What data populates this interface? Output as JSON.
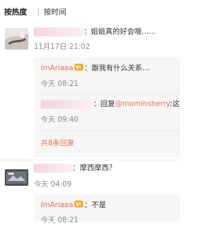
{
  "sort": {
    "hot_label": "按热度",
    "time_label": "按时间"
  },
  "comments": [
    {
      "text": "：姐姐真的好会哦……",
      "time": "11月17日 21:02",
      "replies": [
        {
          "author": "ImAriaaa",
          "text": "：跟我有什么关系…",
          "time": "今天 08:21"
        },
        {
          "prefix": "：回复",
          "mention": "@mominsherry",
          "suffix": ":这",
          "time": "今天 09:40"
        }
      ],
      "more_label": "共8条回复"
    },
    {
      "text": "：摩西摩西？",
      "time": "今天 04:09",
      "replies": [
        {
          "author": "ImAriaaa",
          "text": "：不是",
          "time": "今天 08:21"
        }
      ]
    }
  ],
  "colors": {
    "link": "#eb7350",
    "time": "#8a8a8a",
    "reply_bg": "#f6f6f6"
  },
  "icons": {
    "vip_badge": "vip-badge-icon"
  }
}
